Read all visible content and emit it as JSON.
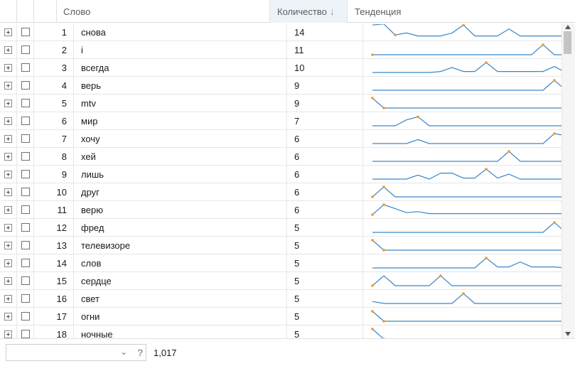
{
  "columns": {
    "word": "Слово",
    "count": "Количество",
    "count_sort_icon": "sort-descending-icon",
    "trend": "Тенденция"
  },
  "rows": [
    {
      "n": "1",
      "word": "снова",
      "count": "14",
      "trend": [
        1.2,
        1.3,
        0.2,
        0.4,
        0.1,
        0.1,
        0.1,
        0.4,
        1.2,
        0.1,
        0.1,
        0.1,
        0.8,
        0.1,
        0.1,
        0.1,
        0.1,
        0.1
      ],
      "marks": [
        2,
        8,
        17
      ]
    },
    {
      "n": "2",
      "word": "i",
      "count": "11",
      "trend": [
        0,
        0,
        0,
        0,
        0,
        0,
        0,
        0,
        0,
        0,
        0,
        0,
        0,
        0,
        0,
        1,
        0,
        0
      ],
      "marks": [
        0,
        15,
        17
      ]
    },
    {
      "n": "3",
      "word": "всегда",
      "count": "10",
      "trend": [
        0,
        0,
        0,
        0,
        0,
        0,
        0.1,
        0.5,
        0.1,
        0.1,
        1,
        0.1,
        0.1,
        0.1,
        0.1,
        0.1,
        0.6,
        0
      ],
      "marks": [
        10,
        17
      ]
    },
    {
      "n": "4",
      "word": "верь",
      "count": "9",
      "trend": [
        0,
        0,
        0,
        0,
        0,
        0,
        0,
        0,
        0,
        0,
        0,
        0,
        0,
        0,
        0,
        0,
        1,
        0
      ],
      "marks": [
        16,
        17
      ]
    },
    {
      "n": "5",
      "word": "mtv",
      "count": "9",
      "trend": [
        1,
        0,
        0,
        0,
        0,
        0,
        0,
        0,
        0,
        0,
        0,
        0,
        0,
        0,
        0,
        0,
        0,
        0
      ],
      "marks": [
        0,
        1,
        17
      ]
    },
    {
      "n": "6",
      "word": "мир",
      "count": "7",
      "trend": [
        0,
        0,
        0,
        0.6,
        0.9,
        0,
        0,
        0,
        0,
        0,
        0,
        0,
        0,
        0,
        0,
        0,
        0,
        0
      ],
      "marks": [
        4,
        17
      ]
    },
    {
      "n": "7",
      "word": "хочу",
      "count": "6",
      "trend": [
        0,
        0,
        0,
        0,
        0.4,
        0,
        0,
        0,
        0,
        0,
        0,
        0,
        0,
        0,
        0,
        0,
        1,
        0.8
      ],
      "marks": [
        16,
        17
      ]
    },
    {
      "n": "8",
      "word": "хей",
      "count": "6",
      "trend": [
        0,
        0,
        0,
        0,
        0,
        0,
        0,
        0,
        0,
        0,
        0,
        0,
        1,
        0,
        0,
        0,
        0,
        0
      ],
      "marks": [
        12,
        17
      ]
    },
    {
      "n": "9",
      "word": "лишь",
      "count": "6",
      "trend": [
        0,
        0,
        0,
        0,
        0.4,
        0,
        0.6,
        0.6,
        0.1,
        0.1,
        1,
        0.1,
        0.5,
        0,
        0,
        0,
        0,
        0
      ],
      "marks": [
        10,
        17
      ]
    },
    {
      "n": "10",
      "word": "друг",
      "count": "6",
      "trend": [
        0,
        1,
        0,
        0,
        0,
        0,
        0,
        0,
        0,
        0,
        0,
        0,
        0,
        0,
        0,
        0,
        0,
        0
      ],
      "marks": [
        0,
        1,
        17
      ]
    },
    {
      "n": "11",
      "word": "верю",
      "count": "6",
      "trend": [
        0,
        1,
        0.6,
        0.2,
        0.3,
        0.1,
        0.1,
        0.1,
        0.1,
        0.1,
        0.1,
        0.1,
        0.1,
        0.1,
        0.1,
        0.1,
        0.1,
        0.1
      ],
      "marks": [
        0,
        1,
        17
      ]
    },
    {
      "n": "12",
      "word": "фред",
      "count": "5",
      "trend": [
        0,
        0,
        0,
        0,
        0,
        0,
        0,
        0,
        0,
        0,
        0,
        0,
        0,
        0,
        0,
        0,
        1,
        0
      ],
      "marks": [
        16,
        17
      ]
    },
    {
      "n": "13",
      "word": "телевизоре",
      "count": "5",
      "trend": [
        1,
        0,
        0,
        0,
        0,
        0,
        0,
        0,
        0,
        0,
        0,
        0,
        0,
        0,
        0,
        0,
        0,
        0
      ],
      "marks": [
        0,
        1,
        17
      ]
    },
    {
      "n": "14",
      "word": "слов",
      "count": "5",
      "trend": [
        0,
        0,
        0,
        0,
        0,
        0,
        0,
        0,
        0,
        0,
        1,
        0.1,
        0.1,
        0.6,
        0.1,
        0.1,
        0.1,
        0
      ],
      "marks": [
        10,
        17
      ]
    },
    {
      "n": "15",
      "word": "сердце",
      "count": "5",
      "trend": [
        0,
        1,
        0,
        0,
        0,
        0,
        1,
        0,
        0,
        0,
        0,
        0,
        0,
        0,
        0,
        0,
        0,
        0
      ],
      "marks": [
        0,
        6,
        17
      ]
    },
    {
      "n": "16",
      "word": "свет",
      "count": "5",
      "trend": [
        0.2,
        0,
        0,
        0,
        0,
        0,
        0,
        0,
        1,
        0,
        0,
        0,
        0,
        0,
        0,
        0,
        0,
        0
      ],
      "marks": [
        8,
        17
      ]
    },
    {
      "n": "17",
      "word": "огни",
      "count": "5",
      "trend": [
        1,
        0,
        0,
        0,
        0,
        0,
        0,
        0,
        0,
        0,
        0,
        0,
        0,
        0,
        0,
        0,
        0,
        0
      ],
      "marks": [
        0,
        1,
        17
      ]
    },
    {
      "n": "18",
      "word": "ночные",
      "count": "5",
      "trend": [
        1,
        0,
        0,
        0,
        0,
        0,
        0,
        0,
        0,
        0,
        0,
        0,
        0,
        0,
        0,
        0,
        0,
        0
      ],
      "marks": [
        0,
        1,
        17
      ]
    }
  ],
  "footer": {
    "select_value": "",
    "chevron_icon": "chevron-down-icon",
    "help_icon": "help-icon",
    "help_glyph": "?",
    "total": "1,017"
  },
  "colors": {
    "sparkline": "#3a86c8",
    "marker": "#f0a030",
    "header_sorted_bg": "#eef3f9"
  }
}
